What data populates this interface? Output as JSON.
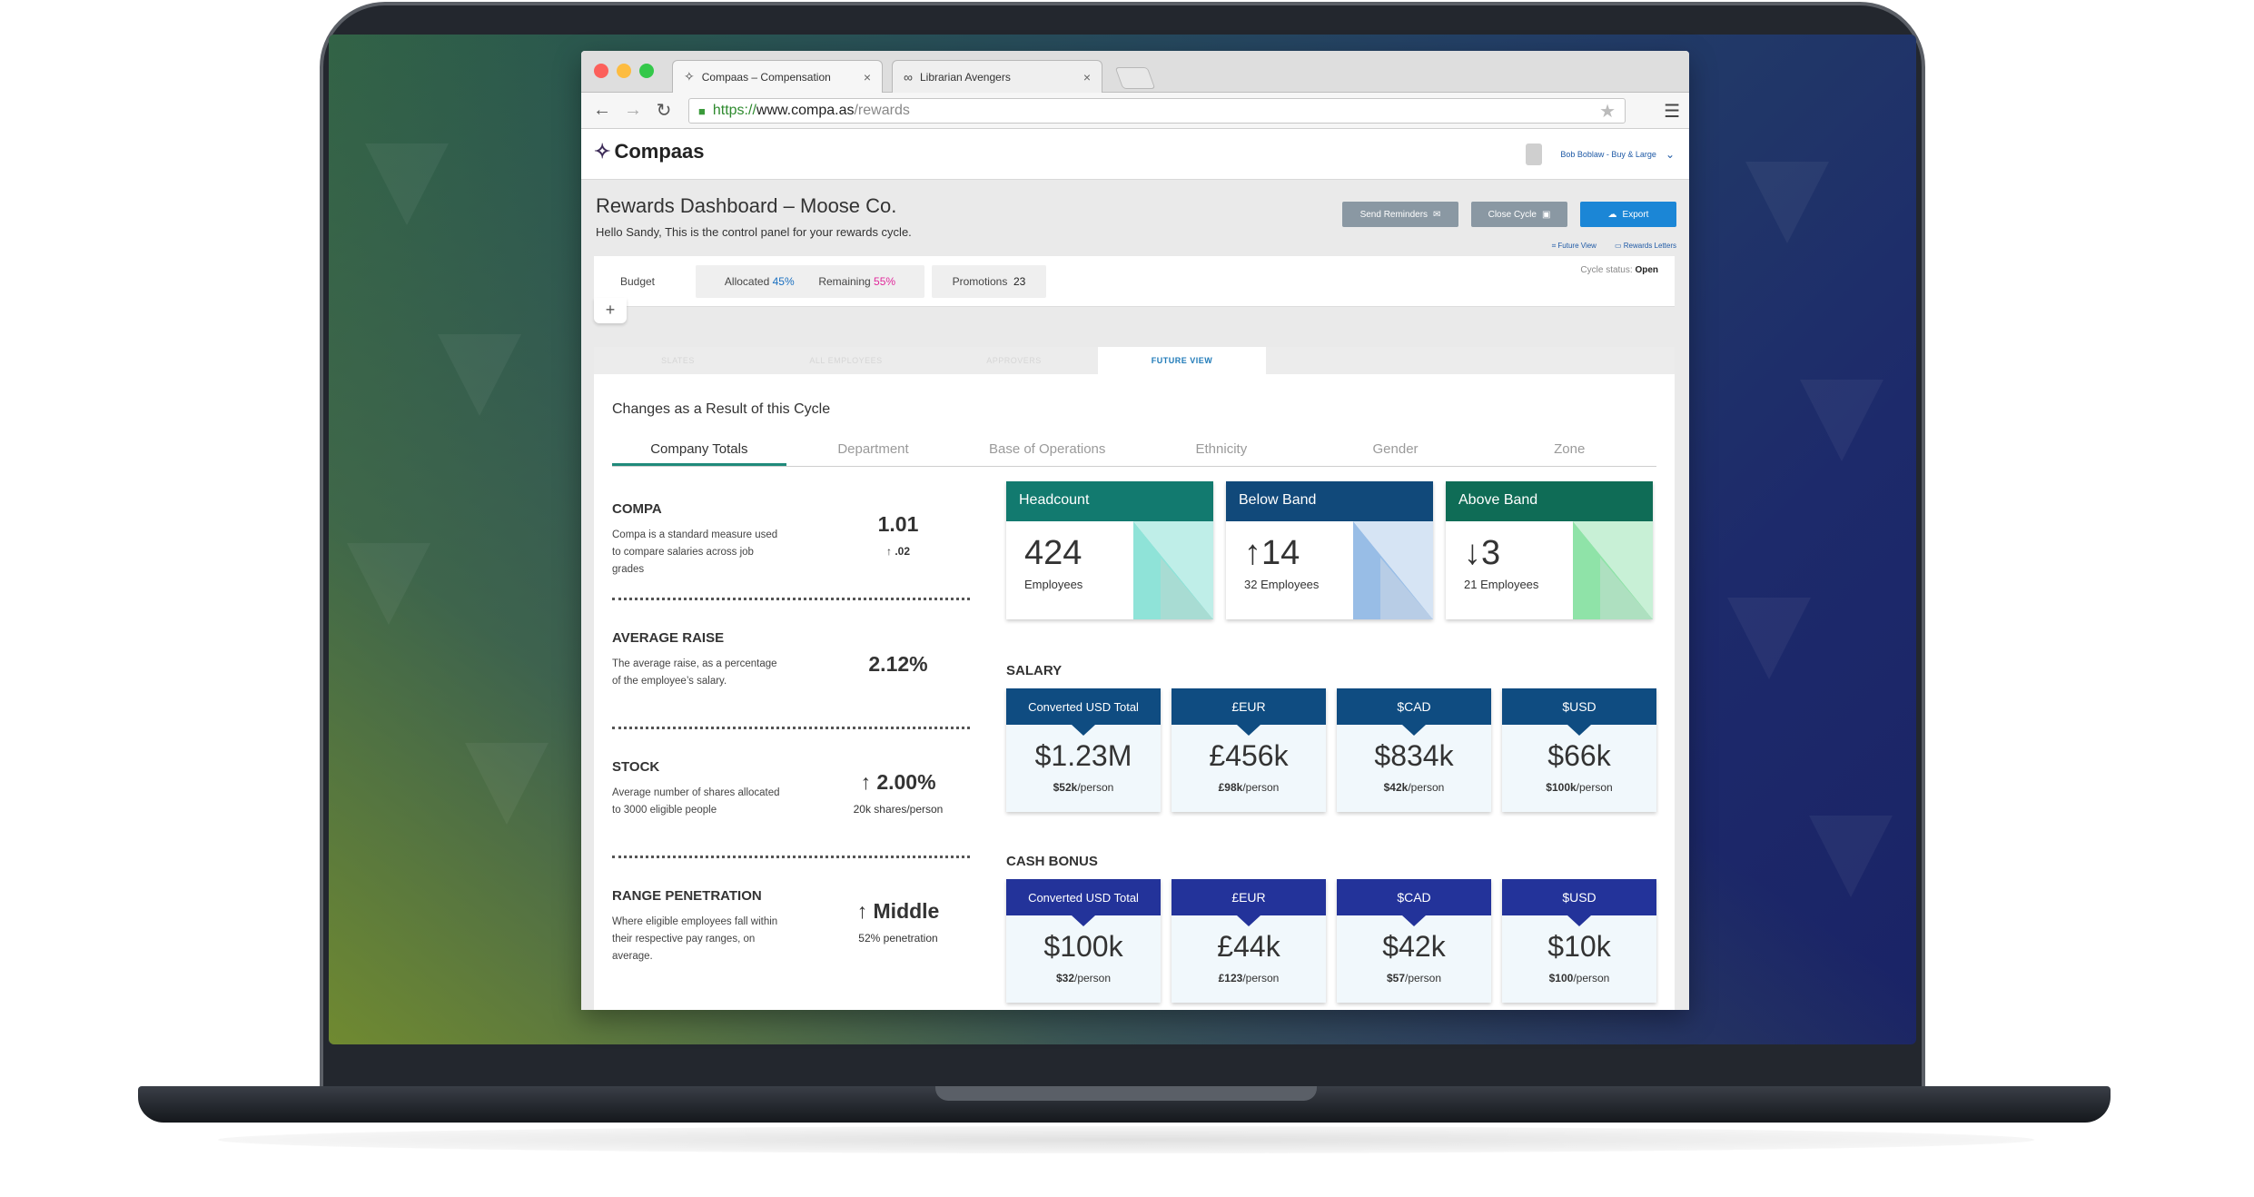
{
  "browser": {
    "tabs": [
      {
        "label": "Compaas – Compensation",
        "icon": "compaas-logo-icon"
      },
      {
        "label": "Librarian Avengers",
        "icon": "glasses-icon"
      }
    ],
    "url": {
      "protocol": "https://",
      "host": "www.compa.as",
      "path": "/rewards"
    }
  },
  "app": {
    "brand": "Compaas",
    "user": "Bob Boblaw - Buy & Large",
    "page_title": "Rewards Dashboard – Moose Co.",
    "greeting": "Hello Sandy, This is the control panel for your rewards cycle.",
    "actions": {
      "send_reminders": "Send Reminders",
      "close_cycle": "Close Cycle",
      "export": "Export"
    },
    "links": {
      "future_view": "Future View",
      "rewards_letters": "Rewards Letters"
    },
    "cycle_status_label": "Cycle status:",
    "cycle_status": "Open",
    "budget": {
      "label": "Budget",
      "allocated_label": "Allocated",
      "allocated_value": "45%",
      "remaining_label": "Remaining",
      "remaining_value": "55%",
      "promotions_label": "Promotions",
      "promotions_value": "23"
    },
    "views": [
      "SLATES",
      "ALL EMPLOYEES",
      "APPROVERS",
      "FUTURE VIEW"
    ],
    "active_view": "FUTURE VIEW",
    "section_title": "Changes as a Result of this Cycle",
    "filters": [
      "Company Totals",
      "Department",
      "Base of Operations",
      "Ethnicity",
      "Gender",
      "Zone"
    ],
    "active_filter": "Company Totals",
    "metrics": [
      {
        "name": "COMPA",
        "desc": "Compa is a standard measure used to compare salaries across job grades",
        "value": "1.01",
        "sub": "↑ .02"
      },
      {
        "name": "AVERAGE RAISE",
        "desc": "The average raise, as a percentage of the employee’s salary.",
        "value": "2.12%",
        "sub": ""
      },
      {
        "name": "STOCK",
        "desc": "Average number of shares allocated to 3000 eligible people",
        "value": "↑ 2.00%",
        "sub": "20k shares/person"
      },
      {
        "name": "RANGE PENETRATION",
        "desc": "Where eligible employees fall within their respective pay ranges, on average.",
        "value": "↑ Middle",
        "sub": "52% penetration"
      }
    ],
    "kpis": [
      {
        "title": "Headcount",
        "value": "424",
        "label": "Employees",
        "color": "#127a6f"
      },
      {
        "title": "Below Band",
        "value": "↑14",
        "label_bold": "32",
        "label": "Employees",
        "color": "#11497a"
      },
      {
        "title": "Above Band",
        "value": "↓3",
        "label_bold": "21",
        "label": "Employees",
        "color": "#0f6c56"
      }
    ],
    "salary": {
      "title": "SALARY",
      "cards": [
        {
          "head": "Converted USD Total",
          "value": "$1.23M",
          "sub_bold": "$52k",
          "sub": "/person"
        },
        {
          "head": "£EUR",
          "value": "£456k",
          "sub_bold": "£98k",
          "sub": "/person"
        },
        {
          "head": "$CAD",
          "value": "$834k",
          "sub_bold": "$42k",
          "sub": "/person"
        },
        {
          "head": "$USD",
          "value": "$66k",
          "sub_bold": "$100k",
          "sub": "/person"
        }
      ]
    },
    "bonus": {
      "title": "CASH BONUS",
      "cards": [
        {
          "head": "Converted USD Total",
          "value": "$100k",
          "sub_bold": "$32",
          "sub": "/person"
        },
        {
          "head": "£EUR",
          "value": "£44k",
          "sub_bold": "£123",
          "sub": "/person"
        },
        {
          "head": "$CAD",
          "value": "$42k",
          "sub_bold": "$57",
          "sub": "/person"
        },
        {
          "head": "$USD",
          "value": "$10k",
          "sub_bold": "$100",
          "sub": "/person"
        }
      ]
    }
  }
}
